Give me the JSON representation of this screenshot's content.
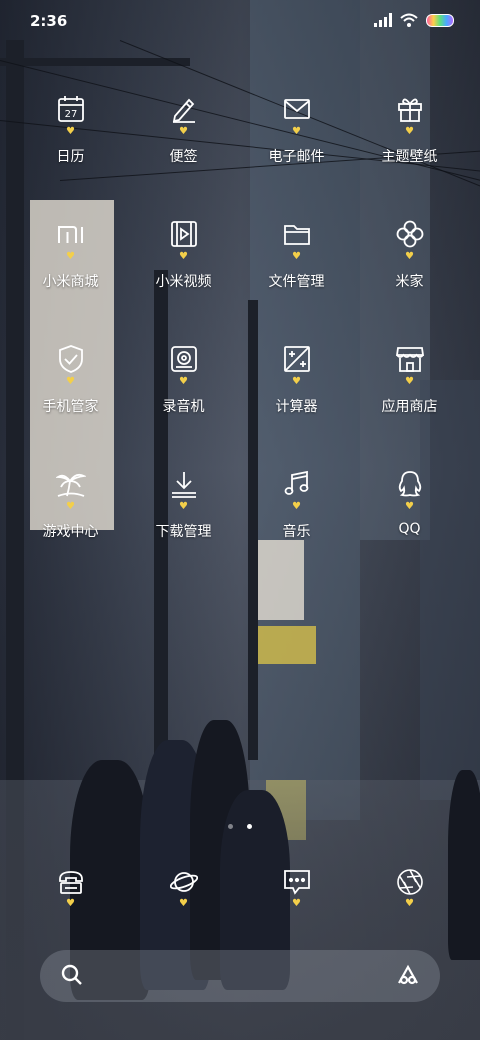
{
  "status_bar": {
    "time": "2:36"
  },
  "apps": [
    {
      "label": "日历",
      "icon": "calendar-icon",
      "badge": "♥"
    },
    {
      "label": "便签",
      "icon": "pen-icon",
      "badge": "♥"
    },
    {
      "label": "电子邮件",
      "icon": "mail-icon",
      "badge": "♥"
    },
    {
      "label": "主题壁纸",
      "icon": "gift-icon",
      "badge": "♥"
    },
    {
      "label": "小米商城",
      "icon": "mi-logo-icon",
      "badge": "♥"
    },
    {
      "label": "小米视频",
      "icon": "film-icon",
      "badge": "♥"
    },
    {
      "label": "文件管理",
      "icon": "folder-icon",
      "badge": "♥"
    },
    {
      "label": "米家",
      "icon": "clover-icon",
      "badge": "♥"
    },
    {
      "label": "手机管家",
      "icon": "shield-icon",
      "badge": "♥"
    },
    {
      "label": "录音机",
      "icon": "recorder-icon",
      "badge": "♥"
    },
    {
      "label": "计算器",
      "icon": "calculator-icon",
      "badge": "♥"
    },
    {
      "label": "应用商店",
      "icon": "store-icon",
      "badge": "♥"
    },
    {
      "label": "游戏中心",
      "icon": "palm-tree-icon",
      "badge": "♥"
    },
    {
      "label": "下载管理",
      "icon": "download-icon",
      "badge": "♥"
    },
    {
      "label": "音乐",
      "icon": "music-note-icon",
      "badge": "♥"
    },
    {
      "label": "QQ",
      "icon": "qq-penguin-icon",
      "badge": "♥"
    }
  ],
  "dock": [
    {
      "icon": "phone-icon",
      "badge": "♥"
    },
    {
      "icon": "planet-icon",
      "badge": "♥"
    },
    {
      "icon": "message-icon",
      "badge": "♥"
    },
    {
      "icon": "camera-shutter-icon",
      "badge": "♥"
    }
  ],
  "pager": {
    "pages": 2,
    "current": 2
  },
  "colors": {
    "badge": "#f3cf4a",
    "text": "#ffffff"
  }
}
